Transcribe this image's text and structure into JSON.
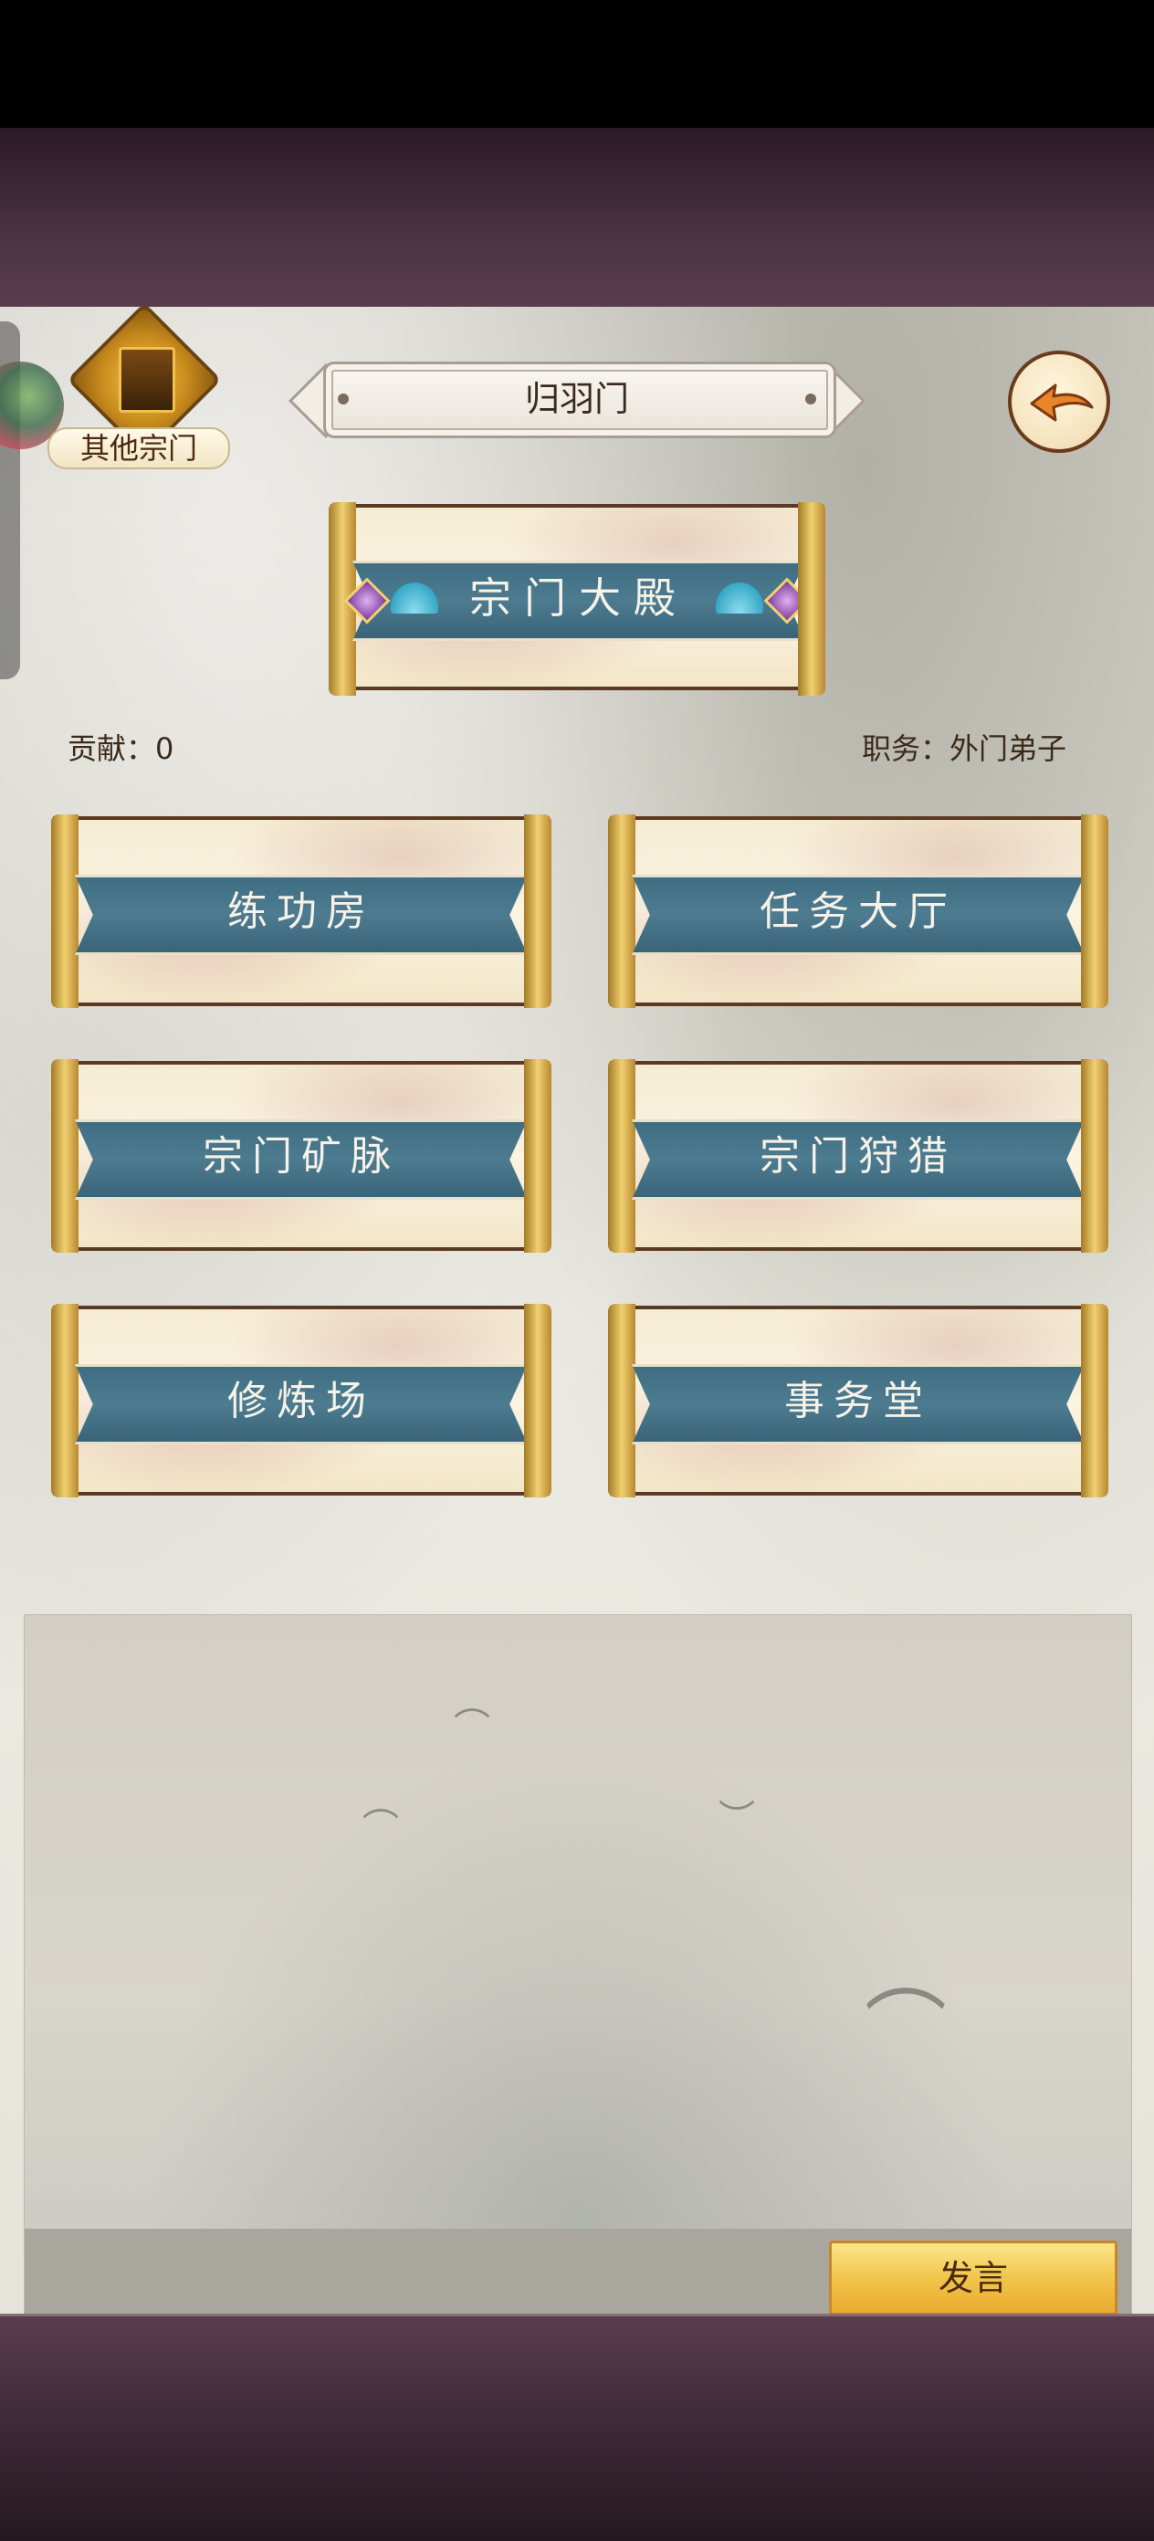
{
  "header": {
    "title": "归羽门",
    "other_sects_label": "其他宗门",
    "back_icon": "back-arrow-icon"
  },
  "hall": {
    "label": "宗门大殿"
  },
  "stats": {
    "contribution": "贡献：0",
    "position": "职务：外门弟子"
  },
  "buildings": [
    {
      "label": "练功房"
    },
    {
      "label": "任务大厅"
    },
    {
      "label": "宗门矿脉"
    },
    {
      "label": "宗门狩猎"
    },
    {
      "label": "修炼场"
    },
    {
      "label": "事务堂"
    }
  ],
  "chat": {
    "input_value": "",
    "send_label": "发言"
  },
  "colors": {
    "ribbon": "#4d7b90",
    "gold": "#f0d070",
    "send_button": "#f2c54c"
  }
}
